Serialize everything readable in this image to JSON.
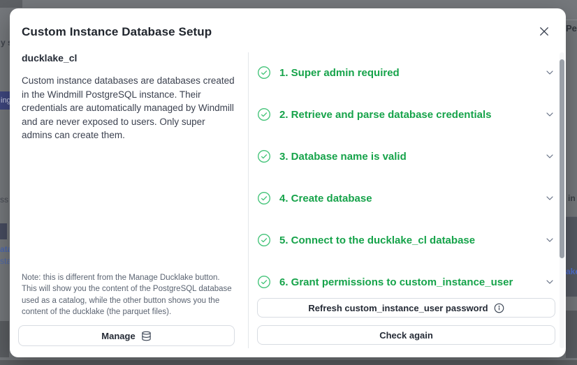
{
  "colors": {
    "accent-green": "#16a34a",
    "icon-green": "#41c377",
    "chevron-gray": "#667085"
  },
  "modal": {
    "title": "Custom Instance Database Setup",
    "left": {
      "heading": "ducklake_cl",
      "description": "Custom instance databases are databases created in the Windmill PostgreSQL instance. Their credentials are automatically managed by Windmill and are never exposed to users. Only super admins can create them.",
      "note": "Note: this is different from the Manage Ducklake button. This will show you the content of the PostgreSQL database used as a catalog, while the other button shows you the content of the ducklake (the parquet files).",
      "manage_button": "Manage"
    },
    "steps": [
      {
        "label": "1. Super admin required",
        "status": "success"
      },
      {
        "label": "2. Retrieve and parse database credentials",
        "status": "success"
      },
      {
        "label": "3. Database name is valid",
        "status": "success"
      },
      {
        "label": "4. Create database",
        "status": "success"
      },
      {
        "label": "5. Connect to the ducklake_cl database",
        "status": "success"
      },
      {
        "label": "6. Grant permissions to custom_instance_user",
        "status": "success"
      }
    ],
    "buttons": {
      "refresh": "Refresh custom_instance_user password",
      "check_again": "Check again"
    }
  },
  "background": {
    "fragments": {
      "ys": "y s",
      "ing": "ing",
      "ss": "ss",
      "ata": "ata",
      "sta": "sta",
      "pe": "Pe",
      "sin": "s in",
      "ake": "ake"
    }
  }
}
